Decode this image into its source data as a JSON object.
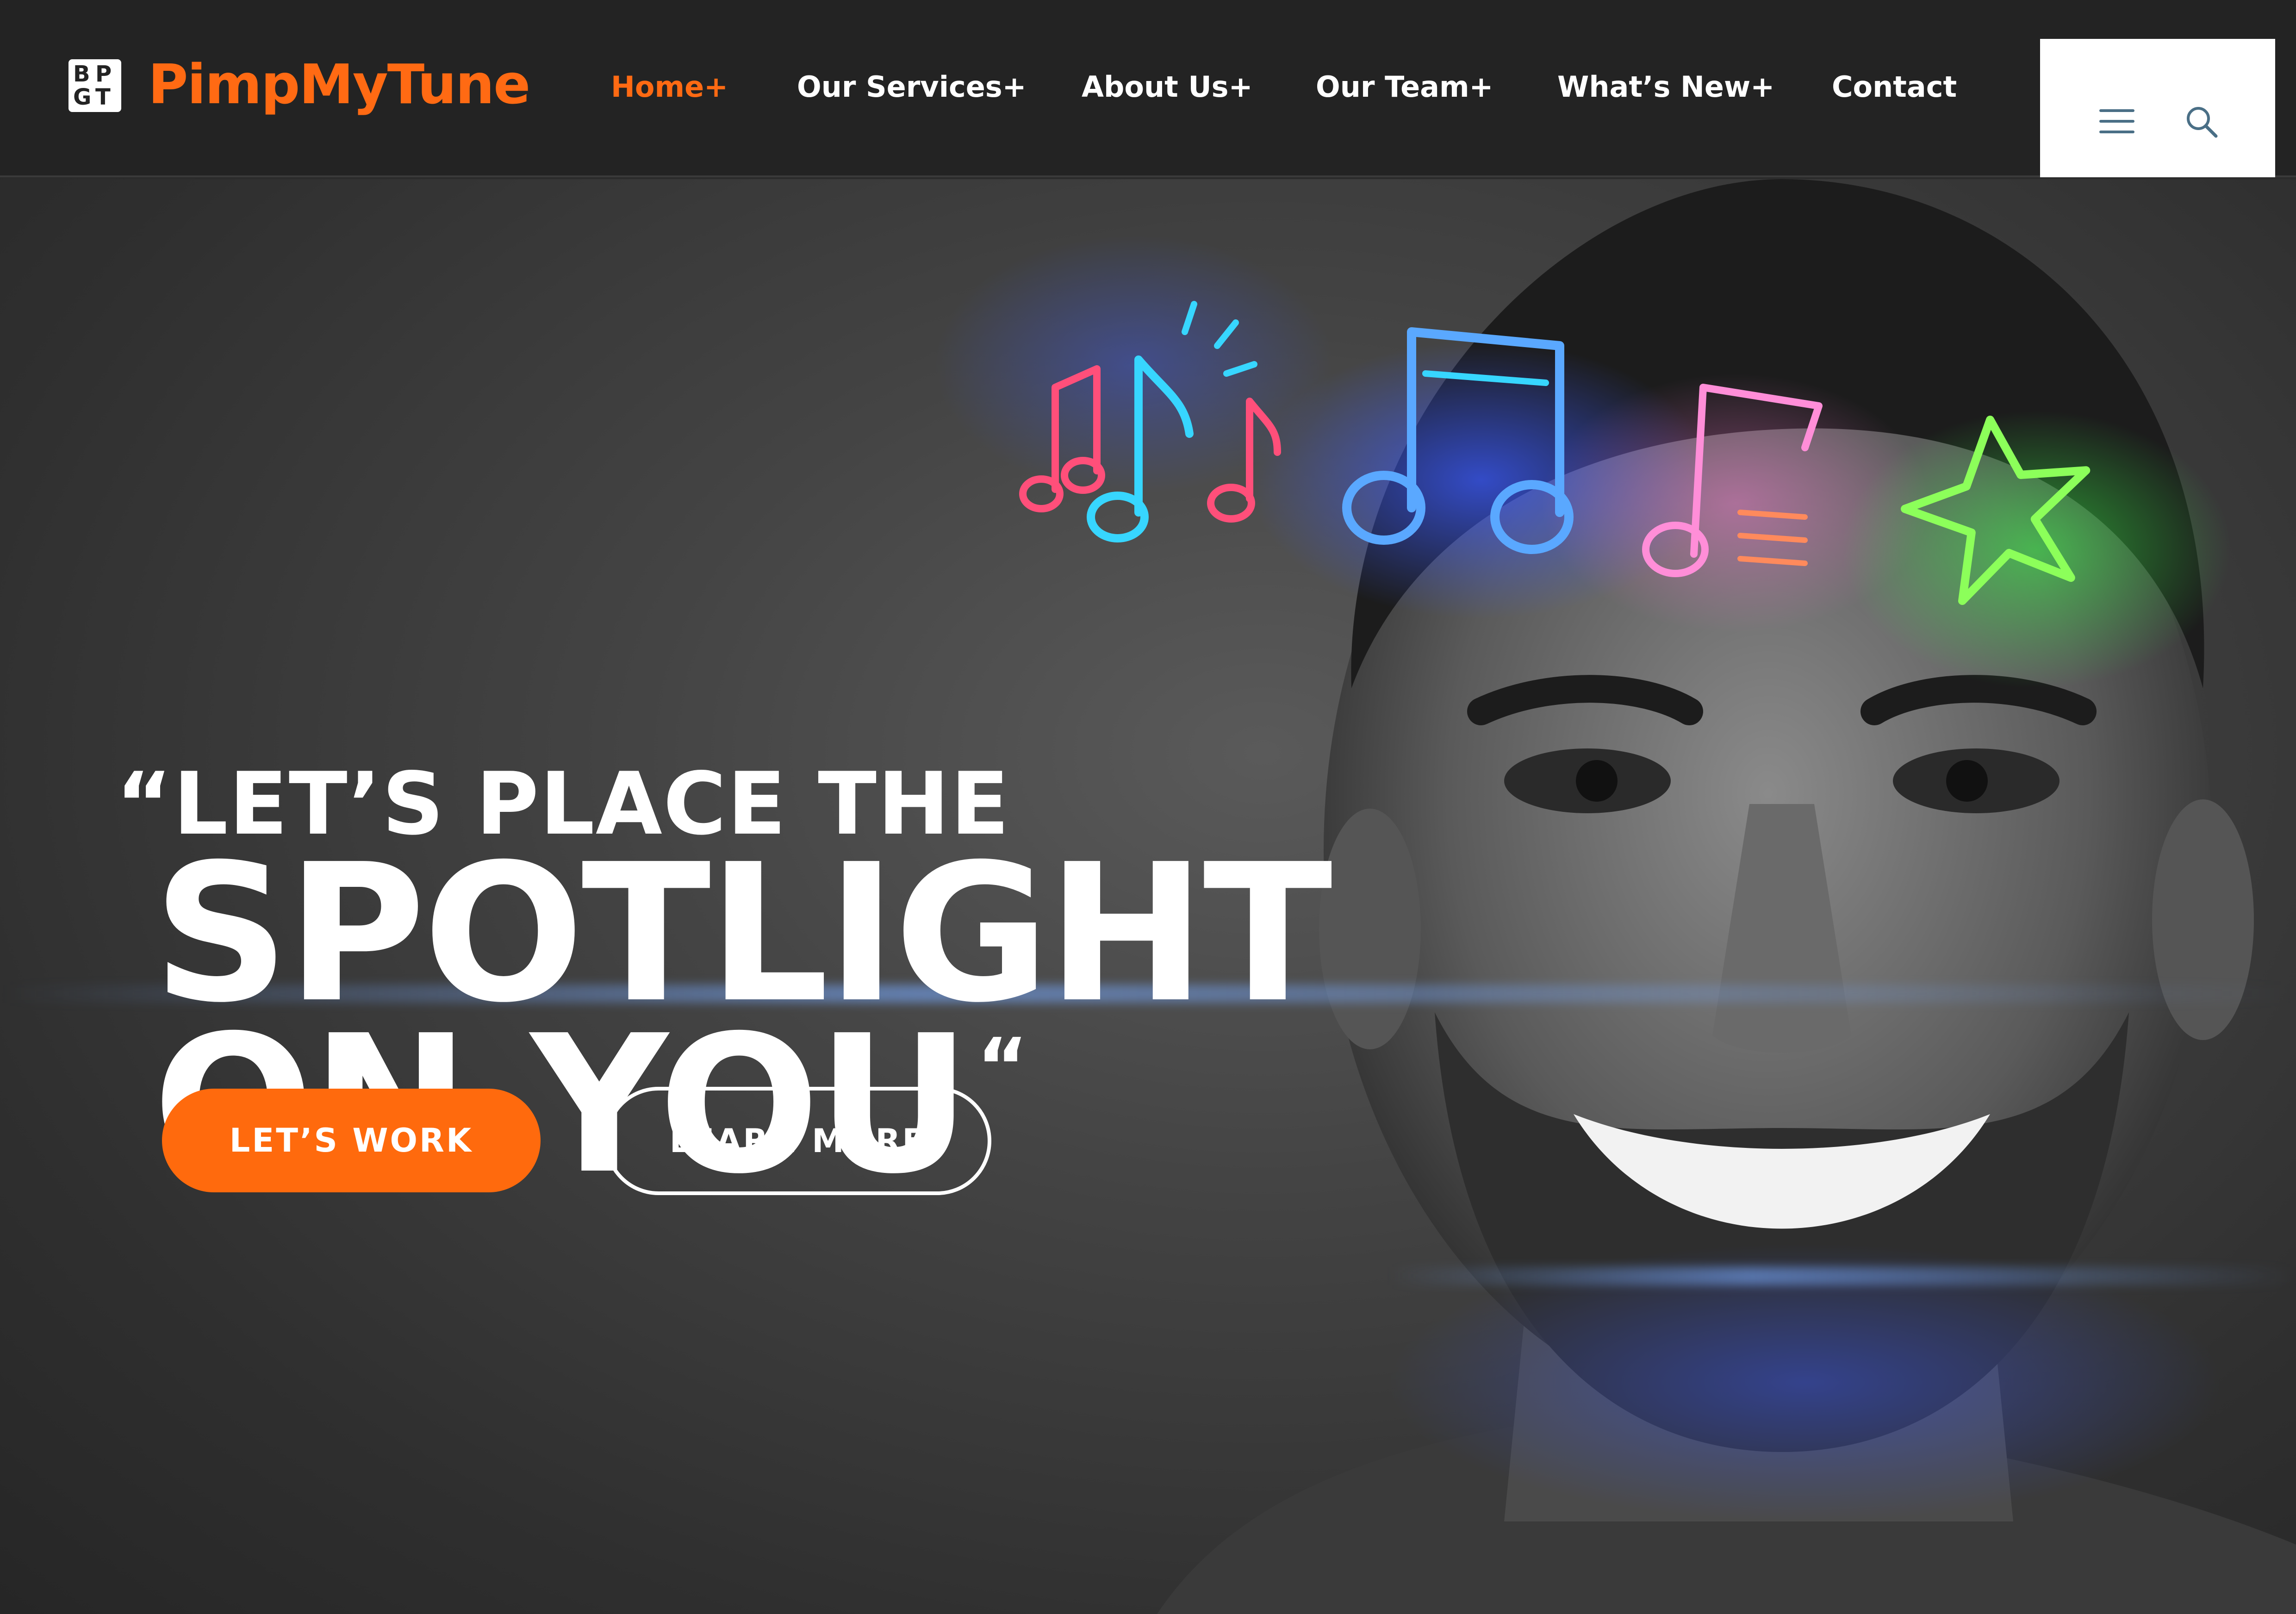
{
  "brand": {
    "logo_letters": [
      "B",
      "P",
      "G",
      "T"
    ],
    "name": "PimpMyTune"
  },
  "nav": {
    "items": [
      {
        "label": "Home+",
        "active": true
      },
      {
        "label": "Our Services+",
        "active": false
      },
      {
        "label": "About Us+",
        "active": false
      },
      {
        "label": "Our Team+",
        "active": false
      },
      {
        "label": "What’s New+",
        "active": false
      },
      {
        "label": "Contact",
        "active": false
      }
    ],
    "icons": [
      "menu-icon",
      "search-icon"
    ]
  },
  "hero": {
    "line1": "“LET’S PLACE THE",
    "line2": "SPOTLIGHT",
    "line3": "ON YOU",
    "close_quote": "“",
    "primary_button": "LET’S WORK",
    "secondary_button": "LEARN MORE",
    "decorations": [
      "music-notes-icon",
      "music-note-icon",
      "music-note-icon",
      "star-icon"
    ]
  },
  "colors": {
    "accent": "#ff6a13",
    "header_bg": "#232323",
    "hero_bg": "#444444",
    "text": "#ffffff",
    "icon": "#4a6f86"
  }
}
